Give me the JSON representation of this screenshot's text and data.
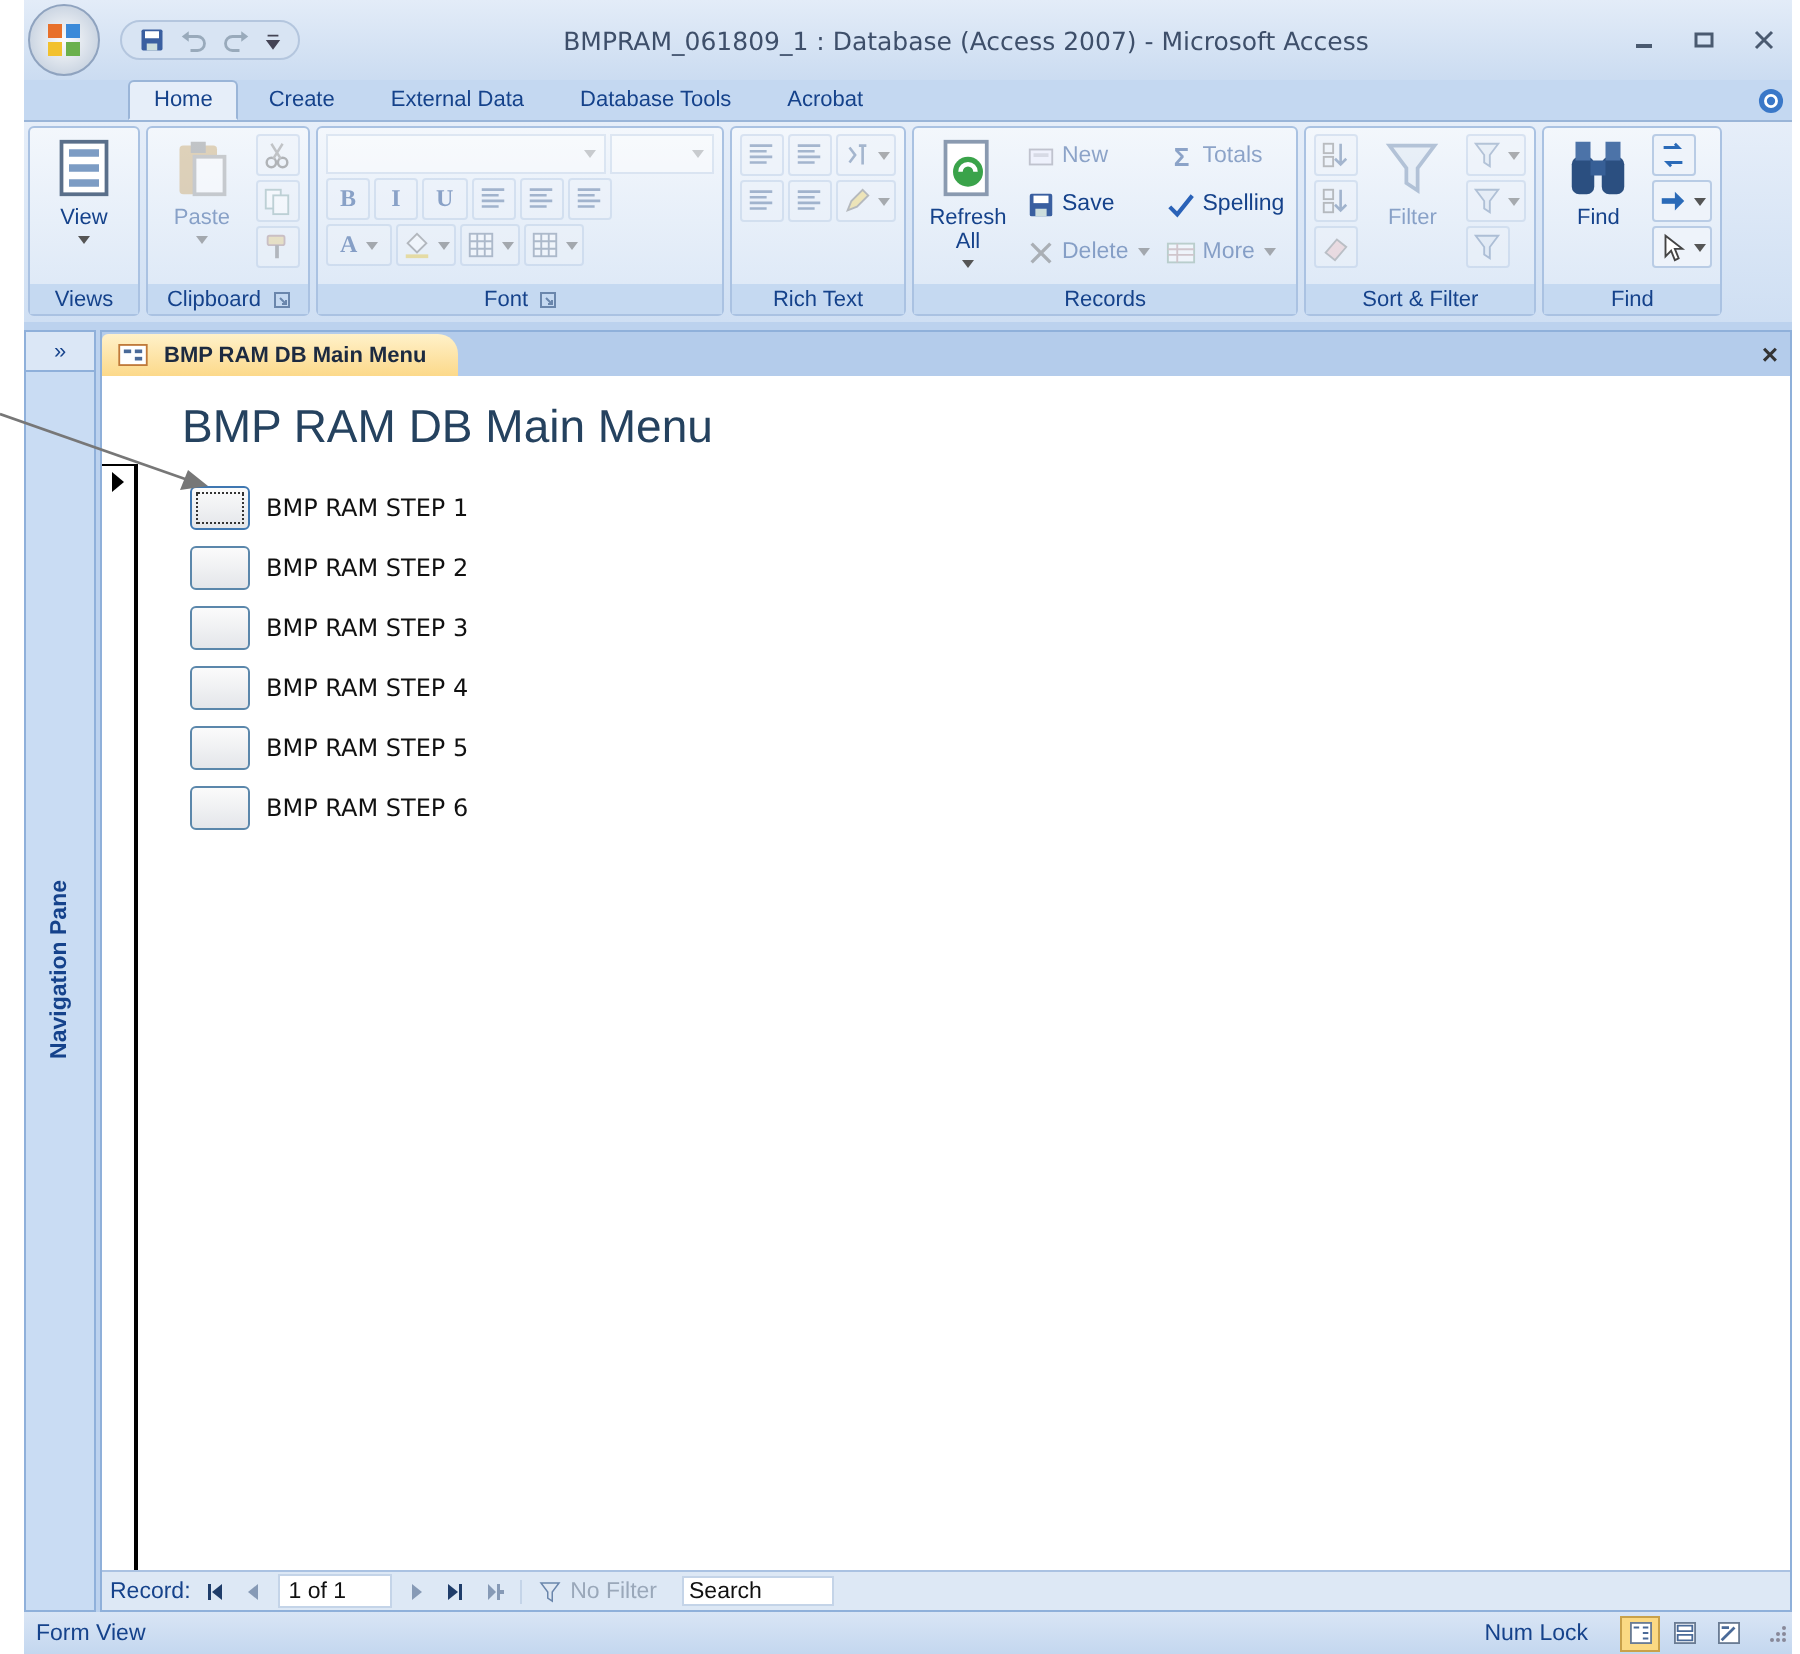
{
  "window": {
    "title": "BMPRAM_061809_1 : Database (Access 2007) - Microsoft Access"
  },
  "ribbon_tabs": [
    {
      "label": "Home",
      "selected": true
    },
    {
      "label": "Create",
      "selected": false
    },
    {
      "label": "External Data",
      "selected": false
    },
    {
      "label": "Database Tools",
      "selected": false
    },
    {
      "label": "Acrobat",
      "selected": false
    }
  ],
  "ribbon": {
    "groups": [
      {
        "label": "Views",
        "launcher": false,
        "columns": [
          {
            "items": [
              {
                "kind": "large",
                "label": "View",
                "dropdown": true,
                "disabled": false
              }
            ]
          }
        ]
      },
      {
        "label": "Clipboard",
        "launcher": true,
        "columns": [
          {
            "items": [
              {
                "kind": "large",
                "label": "Paste",
                "dropdown": true,
                "disabled": true
              }
            ]
          },
          {
            "items": [
              {
                "kind": "icon",
                "disabled": true
              },
              {
                "kind": "icon",
                "disabled": true
              },
              {
                "kind": "icon",
                "disabled": true
              }
            ]
          }
        ]
      },
      {
        "label": "Font",
        "launcher": true,
        "columns": [
          {
            "items": [
              {
                "kind": "bar",
                "items": [
                  {
                    "kind": "combo",
                    "disabled": true
                  },
                  {
                    "kind": "combo",
                    "disabled": true
                  }
                ]
              },
              {
                "kind": "bar",
                "items": [
                  {
                    "kind": "glyph",
                    "glyph": "B",
                    "disabled": true
                  },
                  {
                    "kind": "glyph",
                    "glyph": "I",
                    "disabled": true
                  },
                  {
                    "kind": "glyph",
                    "glyph": "U",
                    "disabled": true
                  },
                  {
                    "kind": "icon",
                    "disabled": true
                  },
                  {
                    "kind": "icon",
                    "disabled": true
                  },
                  {
                    "kind": "icon",
                    "disabled": true
                  }
                ]
              },
              {
                "kind": "bar",
                "items": [
                  {
                    "kind": "glyph",
                    "glyph": "A",
                    "dropdown": true,
                    "disabled": true
                  },
                  {
                    "kind": "icon",
                    "dropdown": true,
                    "disabled": true
                  },
                  {
                    "kind": "icon",
                    "dropdown": true,
                    "disabled": true
                  },
                  {
                    "kind": "icon",
                    "dropdown": true,
                    "disabled": true
                  }
                ]
              }
            ]
          }
        ]
      },
      {
        "label": "Rich Text",
        "launcher": false,
        "columns": [
          {
            "items": [
              {
                "kind": "bar",
                "items": [
                  {
                    "kind": "icon",
                    "disabled": true
                  },
                  {
                    "kind": "icon",
                    "disabled": true
                  },
                  {
                    "kind": "icon",
                    "dropdown": true,
                    "disabled": true
                  }
                ]
              },
              {
                "kind": "bar",
                "items": [
                  {
                    "kind": "icon",
                    "disabled": true
                  },
                  {
                    "kind": "icon",
                    "disabled": true
                  },
                  {
                    "kind": "icon",
                    "dropdown": true,
                    "disabled": true
                  }
                ]
              }
            ]
          }
        ]
      },
      {
        "label": "Records",
        "launcher": false,
        "columns": [
          {
            "items": [
              {
                "kind": "large",
                "label": "Refresh All",
                "dropdown": true,
                "disabled": false
              }
            ]
          },
          {
            "items": [
              {
                "kind": "small",
                "label": "New",
                "disabled": true
              },
              {
                "kind": "small",
                "label": "Save",
                "disabled": false
              },
              {
                "kind": "small",
                "label": "Delete",
                "dropdown": true,
                "disabled": true
              }
            ]
          },
          {
            "items": [
              {
                "kind": "small",
                "glyph": "Σ",
                "label": "Totals",
                "disabled": true
              },
              {
                "kind": "small",
                "label": "Spelling",
                "disabled": false
              },
              {
                "kind": "small",
                "label": "More",
                "dropdown": true,
                "disabled": true
              }
            ]
          }
        ]
      },
      {
        "label": "Sort & Filter",
        "launcher": false,
        "columns": [
          {
            "items": [
              {
                "kind": "icon",
                "disabled": true
              },
              {
                "kind": "icon",
                "disabled": true
              },
              {
                "kind": "icon",
                "disabled": true
              }
            ]
          },
          {
            "items": [
              {
                "kind": "large",
                "label": "Filter",
                "disabled": true
              }
            ]
          },
          {
            "items": [
              {
                "kind": "icon",
                "dropdown": true,
                "disabled": true
              },
              {
                "kind": "icon",
                "dropdown": true,
                "disabled": true
              },
              {
                "kind": "icon",
                "disabled": true
              }
            ]
          }
        ]
      },
      {
        "label": "Find",
        "launcher": false,
        "columns": [
          {
            "items": [
              {
                "kind": "large",
                "label": "Find",
                "disabled": false
              }
            ]
          },
          {
            "items": [
              {
                "kind": "icon",
                "disabled": false
              },
              {
                "kind": "icon",
                "dropdown": true,
                "disabled": false
              },
              {
                "kind": "icon",
                "dropdown": true,
                "disabled": false
              }
            ]
          }
        ]
      }
    ]
  },
  "navigation_pane": {
    "toggle": "»",
    "label": "Navigation Pane"
  },
  "document_tab": {
    "label": "BMP RAM DB Main Menu",
    "close": "×"
  },
  "form": {
    "title": "BMP RAM DB Main Menu",
    "commands": [
      {
        "label": "BMP RAM STEP 1",
        "focused": true
      },
      {
        "label": "BMP RAM STEP 2",
        "focused": false
      },
      {
        "label": "BMP RAM STEP 3",
        "focused": false
      },
      {
        "label": "BMP RAM STEP 4",
        "focused": false
      },
      {
        "label": "BMP RAM STEP 5",
        "focused": false
      },
      {
        "label": "BMP RAM STEP 6",
        "focused": false
      }
    ]
  },
  "record_navigation": {
    "label": "Record:",
    "position": "1 of 1",
    "buttons": [
      {
        "disabled": false
      },
      {
        "disabled": true
      },
      {
        "disabled": true
      },
      {
        "disabled": false
      },
      {
        "disabled": true
      }
    ],
    "filter": "No Filter",
    "search_placeholder": "Search"
  },
  "status_bar": {
    "text": "Form View",
    "num_lock": "Num Lock",
    "views": [
      {
        "selected": true
      },
      {
        "selected": false
      },
      {
        "selected": false
      }
    ]
  }
}
